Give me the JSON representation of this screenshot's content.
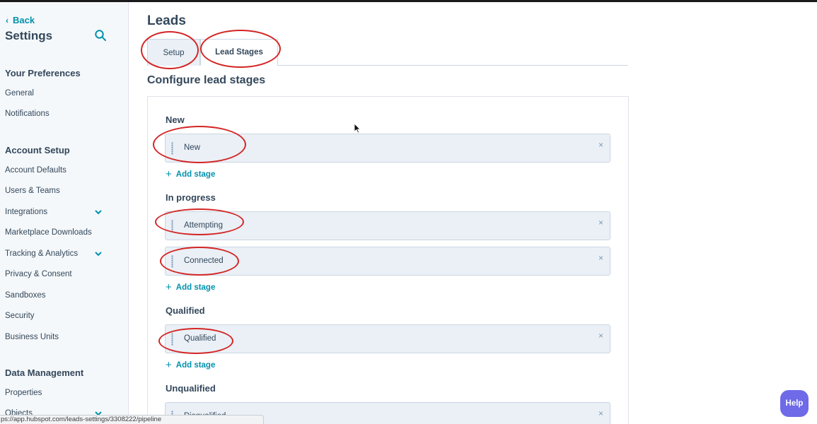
{
  "sidebar": {
    "back_label": "Back",
    "title": "Settings",
    "sections": [
      {
        "heading": "Your Preferences",
        "items": [
          "General",
          "Notifications"
        ]
      },
      {
        "heading": "Account Setup",
        "items": [
          "Account Defaults",
          "Users & Teams",
          "Integrations",
          "Marketplace Downloads",
          "Tracking & Analytics",
          "Privacy & Consent",
          "Sandboxes",
          "Security",
          "Business Units"
        ]
      },
      {
        "heading": "Data Management",
        "items": [
          "Properties",
          "Objects"
        ]
      }
    ]
  },
  "main": {
    "page_title": "Leads",
    "tabs": [
      {
        "label": "Setup",
        "active": false
      },
      {
        "label": "Lead Stages",
        "active": true
      }
    ],
    "section_title": "Configure lead stages",
    "groups": [
      {
        "label": "New",
        "stages": [
          "New"
        ],
        "add_label": "Add stage"
      },
      {
        "label": "In progress",
        "stages": [
          "Attempting",
          "Connected"
        ],
        "add_label": "Add stage"
      },
      {
        "label": "Qualified",
        "stages": [
          "Qualified"
        ],
        "add_label": "Add stage"
      },
      {
        "label": "Unqualified",
        "stages": [
          "Disqualified"
        ]
      }
    ],
    "close_glyph": "×"
  },
  "help_label": "Help",
  "status_url": "ps://app.hubspot.com/leads-settings/3308222/pipeline",
  "colors": {
    "accent": "#0091ae",
    "annotation": "#d42525",
    "help_button": "#6e6ae8",
    "stage_bg": "#eaf0f6"
  },
  "icons": {
    "search": "search-icon",
    "back": "chevron-left-icon",
    "expand": "chevron-down-icon",
    "drag": "drag-handle-icon",
    "close": "close-icon",
    "add": "plus-icon"
  }
}
